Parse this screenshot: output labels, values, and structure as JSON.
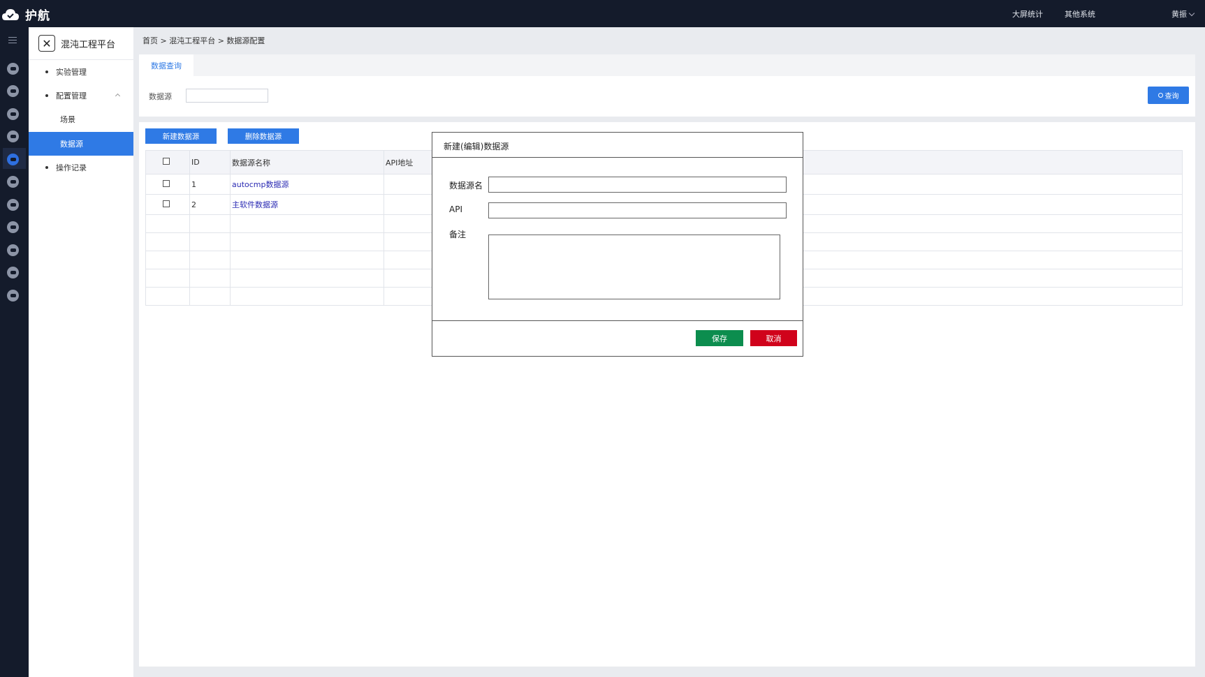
{
  "app": {
    "logo_text": "护航"
  },
  "topnav": {
    "big_screen": "大屏统计",
    "other_systems": "其他系统",
    "user": "黄振"
  },
  "sidebar": {
    "brand": "混沌工程平台",
    "items": [
      {
        "label": "实验管理"
      },
      {
        "label": "配置管理"
      },
      {
        "label": "场景"
      },
      {
        "label": "数据源"
      },
      {
        "label": "操作记录"
      }
    ]
  },
  "breadcrumb": "首页 > 混沌工程平台 > 数据源配置",
  "query": {
    "tab": "数据查询",
    "label": "数据源",
    "input_value": "",
    "button": "查询"
  },
  "toolbar": {
    "new_label": "新建数据源",
    "delete_label": "删除数据源"
  },
  "table": {
    "columns": [
      "ID",
      "数据源名称",
      "API地址"
    ],
    "rows": [
      {
        "id": "1",
        "name": "autocmp数据源",
        "api": ""
      },
      {
        "id": "2",
        "name": "主软件数据源",
        "api": ""
      }
    ]
  },
  "modal": {
    "title": "新建(编辑)数据源",
    "name_label": "数据源名",
    "api_label": "API",
    "note_label": "备注",
    "name_value": "",
    "api_value": "",
    "note_value": "",
    "save": "保存",
    "cancel": "取消"
  },
  "colors": {
    "topbar": "#141b2b",
    "accent": "#2f7ae5",
    "save": "#0c8d4e",
    "cancel": "#d0021b"
  }
}
